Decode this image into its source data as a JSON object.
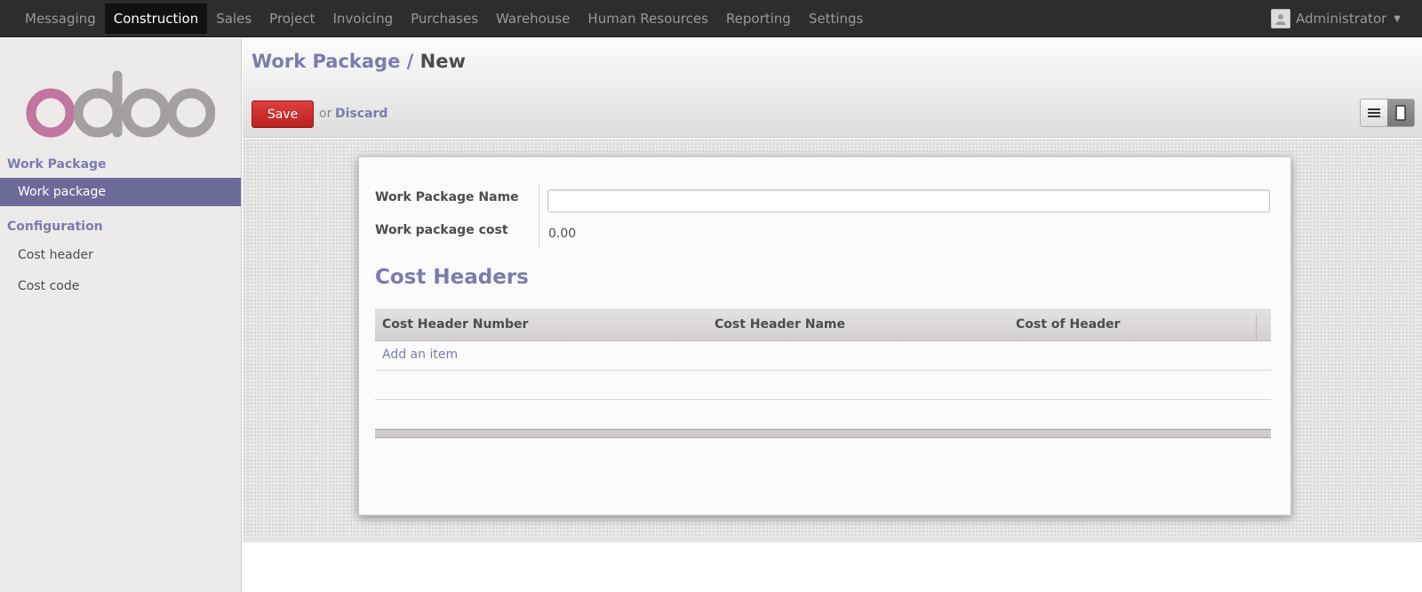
{
  "topbar": {
    "menu": [
      "Messaging",
      "Construction",
      "Sales",
      "Project",
      "Invoicing",
      "Purchases",
      "Warehouse",
      "Human Resources",
      "Reporting",
      "Settings"
    ],
    "user": "Administrator"
  },
  "sidebar": {
    "logo": "odoo",
    "sections": [
      {
        "title": "Work Package",
        "items": [
          "Work package"
        ]
      },
      {
        "title": "Configuration",
        "items": [
          "Cost header",
          "Cost code"
        ]
      }
    ]
  },
  "header": {
    "breadcrumb_parent": "Work Package",
    "breadcrumb_sep": "/",
    "breadcrumb_current": "New",
    "save_label": "Save",
    "or_text": "or",
    "discard_label": "Discard"
  },
  "form": {
    "name_label": "Work Package Name",
    "name_value": "",
    "cost_label": "Work package cost",
    "cost_value": "0.00",
    "section_title": "Cost Headers",
    "columns": [
      "Cost Header Number",
      "Cost Header Name",
      "Cost of Header"
    ],
    "add_item": "Add an item"
  },
  "colors": {
    "accent": "#7c7bad",
    "sidebar_active": "#6b6b9a",
    "save_button": "#c92c2c",
    "topbar": "#2d2d2d"
  }
}
